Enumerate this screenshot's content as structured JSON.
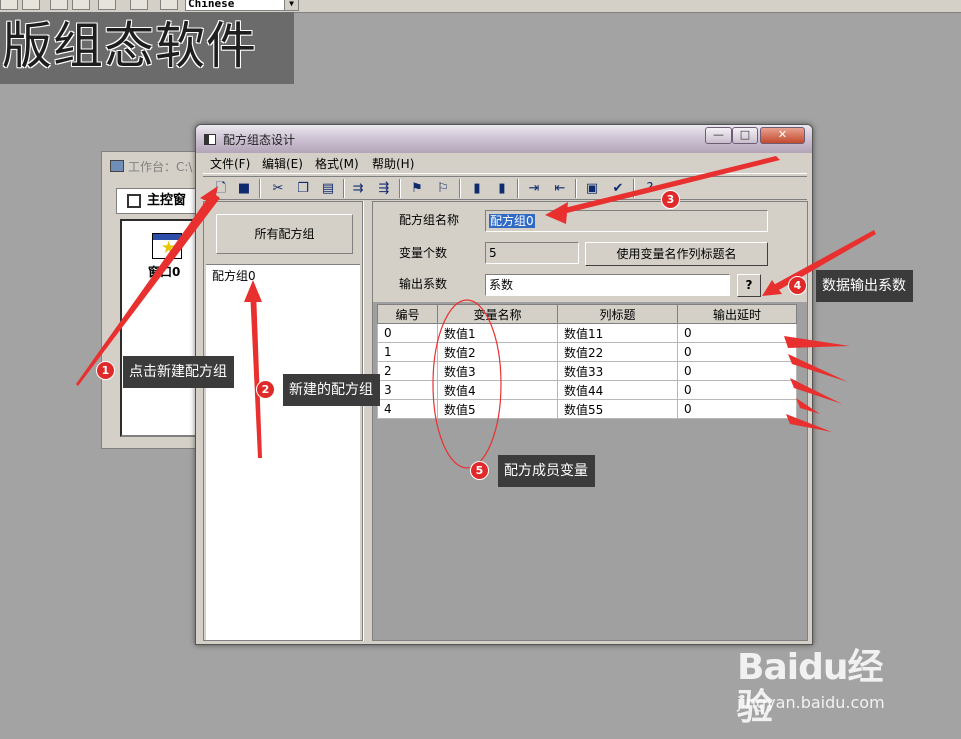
{
  "top_toolbar": {
    "language_select": "Chinese"
  },
  "banner": {
    "text": "版组态软件"
  },
  "workbench": {
    "title": "工作台：C:\\",
    "tab_label": "主控窗",
    "window_item_label": "窗口0"
  },
  "dialog": {
    "title": "配方组态设计",
    "caption_buttons": {
      "minimize": "—",
      "maximize": "□",
      "close": "✕"
    },
    "menu": [
      "文件(F)",
      "编辑(E)",
      "格式(M)",
      "帮助(H)"
    ],
    "toolbar_icons": [
      "new-file-icon",
      "save-icon",
      "cut-icon",
      "copy-icon",
      "paste-icon",
      "insert-row-icon",
      "append-row-icon",
      "flag-icon",
      "flag-alt-icon",
      "move-up-icon",
      "move-down-icon",
      "import-icon",
      "export-icon",
      "properties-icon",
      "check-icon",
      "help-icon"
    ],
    "left": {
      "all_groups_button": "所有配方组",
      "groups": [
        "配方组0"
      ]
    },
    "form": {
      "group_name_label": "配方组名称",
      "group_name_value": "配方组0",
      "var_count_label": "变量个数",
      "var_count_value": "5",
      "use_var_name_button": "使用变量名作列标题名",
      "output_coef_label": "输出系数",
      "output_coef_value": "系数",
      "help_button": "?"
    },
    "table": {
      "headers": [
        "编号",
        "变量名称",
        "列标题",
        "输出延时"
      ],
      "rows": [
        [
          "0",
          "数值1",
          "数值11",
          "0"
        ],
        [
          "1",
          "数值2",
          "数值22",
          "0"
        ],
        [
          "2",
          "数值3",
          "数值33",
          "0"
        ],
        [
          "3",
          "数值4",
          "数值44",
          "0"
        ],
        [
          "4",
          "数值5",
          "数值55",
          "0"
        ]
      ]
    }
  },
  "annotations": [
    {
      "num": "1",
      "text": "点击新建配方组"
    },
    {
      "num": "2",
      "text": "新建的配方组"
    },
    {
      "num": "3",
      "text": ""
    },
    {
      "num": "4",
      "text": "数据输出系数"
    },
    {
      "num": "5",
      "text": "配方成员变量"
    }
  ],
  "colors": {
    "arrow": "#e8312f",
    "callout_bg": "#3b3b3b",
    "desktop": "#a3a3a3"
  },
  "watermark": {
    "logo": "Baidu经验",
    "sub": "jingyan.baidu.com"
  }
}
